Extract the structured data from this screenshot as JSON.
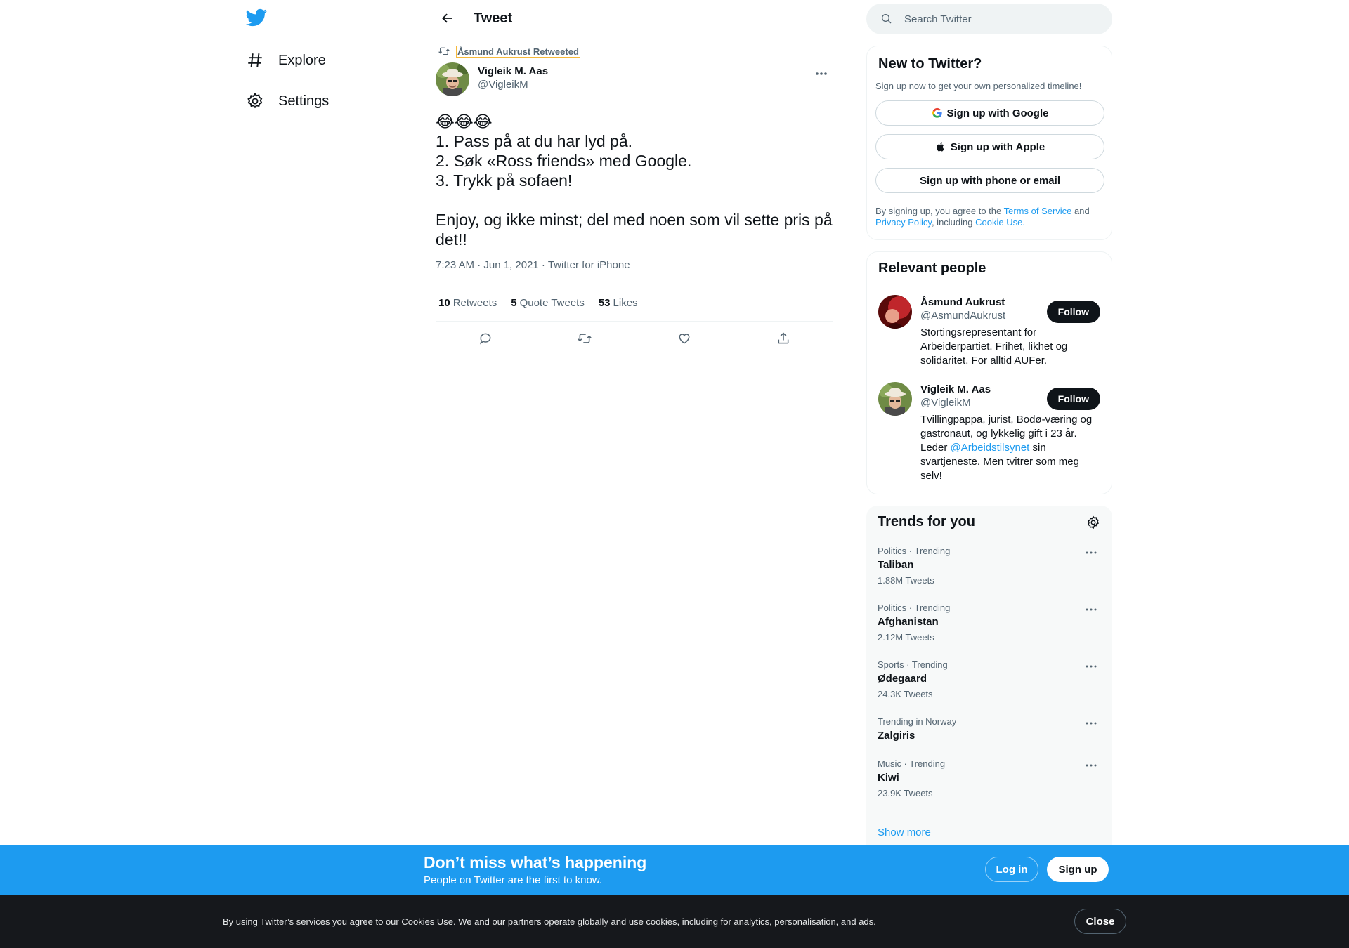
{
  "nav": {
    "logo_icon": "twitter-bird-icon",
    "items": [
      {
        "label": "Explore",
        "icon": "hashtag-icon"
      },
      {
        "label": "Settings",
        "icon": "gear-icon"
      }
    ]
  },
  "header": {
    "title": "Tweet",
    "back_icon": "arrow-left-icon"
  },
  "tweet": {
    "retweeted_by": "Åsmund Aukrust Retweeted",
    "author_name": "Vigleik M. Aas",
    "author_handle": "@VigleikM",
    "text": "😂😂😂\n1. Pass på at du har lyd på.\n2. Søk «Ross friends» med Google.\n3. Trykk på sofaen!\n\nEnjoy, og ikke minst; del med noen som vil sette pris på det!!",
    "timestamp": "7:23 AM · Jun 1, 2021 · Twitter for iPhone",
    "counts": [
      {
        "value": "10",
        "label": "Retweets"
      },
      {
        "value": "5",
        "label": "Quote Tweets"
      },
      {
        "value": "53",
        "label": "Likes"
      }
    ],
    "actions": [
      "reply-icon",
      "retweet-icon",
      "like-icon",
      "share-icon"
    ]
  },
  "search": {
    "placeholder": "Search Twitter"
  },
  "new_to_twitter": {
    "title": "New to Twitter?",
    "subtitle": "Sign up now to get your own personalized timeline!",
    "google": "Sign up with Google",
    "apple": "Sign up with Apple",
    "phone": "Sign up with phone or email",
    "legal_1": "By signing up, you agree to the ",
    "terms": "Terms of Service",
    "legal_2": " and ",
    "privacy": "Privacy Policy",
    "legal_3": ", including ",
    "cookie": "Cookie Use."
  },
  "relevant_people": {
    "title": "Relevant people",
    "people": [
      {
        "name": "Åsmund Aukrust",
        "handle": "@AsmundAukrust",
        "bio": "Stortingsrepresentant for Arbeiderpartiet. Frihet, likhet og solidaritet. For alltid AUFer.",
        "follow": "Follow"
      },
      {
        "name": "Vigleik M. Aas",
        "handle": "@VigleikM",
        "bio_1": "Tvillingpappa, jurist, Bodø-væring og gastronaut, og lykkelig gift i 23 år. Leder ",
        "bio_link": "@Arbeidstilsynet",
        "bio_2": " sin svartjeneste. Men tvitrer som meg selv!",
        "follow": "Follow"
      }
    ]
  },
  "trends": {
    "title": "Trends for you",
    "items": [
      {
        "meta": "Politics · Trending",
        "name": "Taliban",
        "count": "1.88M Tweets"
      },
      {
        "meta": "Politics · Trending",
        "name": "Afghanistan",
        "count": "2.12M Tweets"
      },
      {
        "meta": "Sports · Trending",
        "name": "Ødegaard",
        "count": "24.3K Tweets"
      },
      {
        "meta": "Trending in Norway",
        "name": "Zalgiris",
        "count": ""
      },
      {
        "meta": "Music · Trending",
        "name": "Kiwi",
        "count": "23.9K Tweets"
      }
    ],
    "show_more": "Show more"
  },
  "promo": {
    "title": "Don’t miss what’s happening",
    "subtitle": "People on Twitter are the first to know.",
    "login": "Log in",
    "signup": "Sign up"
  },
  "cookie_bar": {
    "text": "By using Twitter’s services you agree to our Cookies Use. We and our partners operate globally and use cookies, including for analytics, personalisation, and ads.",
    "close": "Close"
  },
  "colors": {
    "accent": "#1d9bf0",
    "text": "#0f1419",
    "muted": "#536471",
    "dark_bar": "#16181c"
  }
}
